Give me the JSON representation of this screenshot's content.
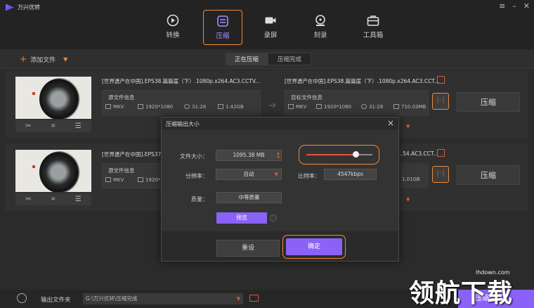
{
  "app": {
    "title": "万兴优转"
  },
  "window_controls": [
    "≡",
    "–",
    "✕"
  ],
  "nav": [
    {
      "label": "转换",
      "icon": "convert-icon"
    },
    {
      "label": "压缩",
      "icon": "compress-icon",
      "active": true
    },
    {
      "label": "录屏",
      "icon": "record-icon"
    },
    {
      "label": "刻录",
      "icon": "burn-icon"
    },
    {
      "label": "工具箱",
      "icon": "toolbox-icon"
    }
  ],
  "toolbar": {
    "add_file": "添加文件"
  },
  "tabs": [
    {
      "label": "正在压缩",
      "active": true
    },
    {
      "label": "压缩完成"
    }
  ],
  "files": [
    {
      "source_name": "[世界遗产在中国].EPS38.篇篇崖（下）.1080p.x264.AC3.CCTV...",
      "target_name": "[世界遗产在中国].EPS38.篇篇崖（下）.1080p.x264.AC3.CCT...",
      "source_label": "源文件信息",
      "target_label": "目标文件信息",
      "src_format": "MKV",
      "src_res": "1920*1080",
      "src_dur": "31:28",
      "src_size": "1.42GB",
      "tgt_format": "MKV",
      "tgt_res": "1920*1080",
      "tgt_dur": "31:28",
      "tgt_size": "710.03MB",
      "compress_label": "压缩"
    },
    {
      "source_name": "[世界遗产在中国].EPS37...",
      "target_name": "...54.AC3.CCT...",
      "source_label": "源文件信息",
      "src_format": "MKV",
      "src_res": "1920*1080",
      "tgt_size": "1.01GB",
      "compress_label": "压缩"
    }
  ],
  "dialog": {
    "title": "压缩输出大小",
    "size_label": "文件大小：",
    "size_value": "1095.38  MB",
    "resolution_label": "分辨率：",
    "resolution_value": "自动",
    "bitrate_label": "比特率：",
    "bitrate_value": "4547kbps",
    "quality_label": "质量：",
    "quality_value": "中等质量",
    "preview_label": "预览",
    "reset_label": "重设",
    "ok_label": "确定",
    "slider_fraction": 0.75
  },
  "bottom": {
    "output_label": "输出文件夹",
    "output_path": "G:\\万兴优转\\压缩完成",
    "all_label": "压缩全部"
  },
  "watermark": {
    "text": "领航下载",
    "url": "lhdown.com"
  },
  "colors": {
    "accent": "#8a62f7",
    "highlight": "#f08a3a",
    "red": "#e2553b"
  }
}
